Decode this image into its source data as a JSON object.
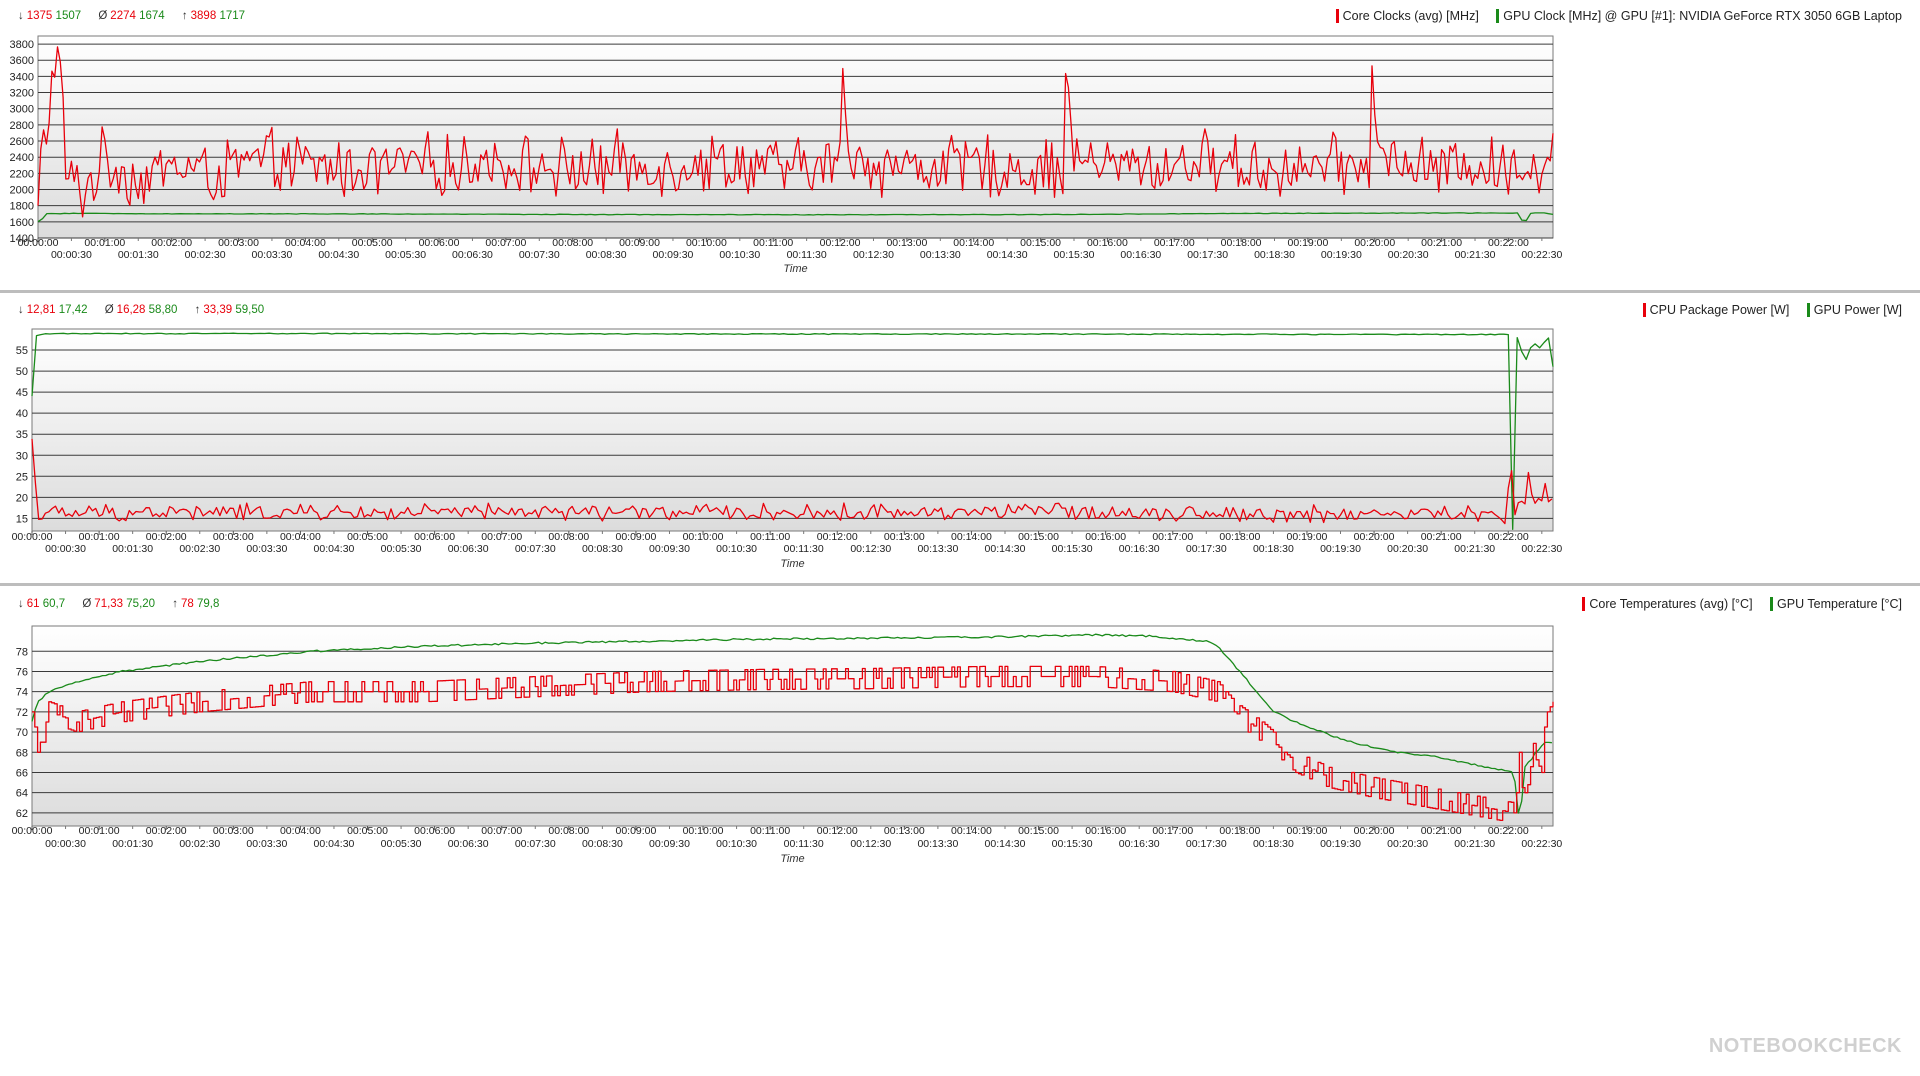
{
  "watermark": "NOTEBOOKCHECK",
  "colors": {
    "red": "#e8000b",
    "green": "#1a8a1a"
  },
  "time_ticks_top": [
    "00:00:00",
    "00:01:00",
    "00:02:00",
    "00:03:00",
    "00:04:00",
    "00:05:00",
    "00:06:00",
    "00:07:00",
    "00:08:00",
    "00:09:00",
    "00:10:00",
    "00:11:00",
    "00:12:00",
    "00:13:00",
    "00:14:00",
    "00:15:00",
    "00:16:00",
    "00:17:00",
    "00:18:00",
    "00:19:00",
    "00:20:00",
    "00:21:00",
    "00:22:00"
  ],
  "time_ticks_bottom": [
    "00:00:30",
    "00:01:30",
    "00:02:30",
    "00:03:30",
    "00:04:30",
    "00:05:30",
    "00:06:30",
    "00:07:30",
    "00:08:30",
    "00:09:30",
    "00:10:30",
    "00:11:30",
    "00:12:30",
    "00:13:30",
    "00:14:30",
    "00:15:30",
    "00:16:30",
    "00:17:30",
    "00:18:30",
    "00:19:30",
    "00:20:30",
    "00:21:30",
    "00:22:30"
  ],
  "chart_data": [
    {
      "type": "line",
      "xlabel": "Time",
      "ylim": [
        1400,
        3900
      ],
      "yticks": [
        1400,
        1600,
        1800,
        2000,
        2200,
        2400,
        2600,
        2800,
        3000,
        3200,
        3400,
        3600,
        3800
      ],
      "xlim_seconds": [
        0,
        1360
      ],
      "stats": {
        "min": {
          "symbol": "↓",
          "red": "1375",
          "green": "1507"
        },
        "avg": {
          "symbol": "Ø",
          "red": "2274",
          "green": "1674"
        },
        "max": {
          "symbol": "↑",
          "red": "3898",
          "green": "1717"
        }
      },
      "series": [
        {
          "name": "Core Clocks (avg) [MHz]",
          "color": "#e8000b",
          "style": "noisy",
          "points": [
            [
              0,
              1700
            ],
            [
              3,
              2500
            ],
            [
              8,
              2700
            ],
            [
              15,
              3650
            ],
            [
              20,
              3500
            ],
            [
              25,
              2200
            ],
            [
              40,
              1950
            ],
            [
              60,
              2400
            ],
            [
              90,
              2100
            ],
            [
              120,
              2300
            ],
            [
              160,
              2200
            ],
            [
              200,
              2350
            ],
            [
              240,
              2300
            ],
            [
              280,
              2250
            ],
            [
              320,
              2300
            ],
            [
              360,
              2280
            ],
            [
              400,
              2350
            ],
            [
              440,
              2300
            ],
            [
              480,
              2250
            ],
            [
              520,
              2300
            ],
            [
              560,
              2280
            ],
            [
              600,
              2350
            ],
            [
              640,
              2300
            ],
            [
              680,
              2250
            ],
            [
              718,
              2300
            ],
            [
              722,
              3500
            ],
            [
              726,
              2400
            ],
            [
              760,
              2300
            ],
            [
              800,
              2280
            ],
            [
              840,
              2300
            ],
            [
              880,
              2250
            ],
            [
              920,
              2300
            ],
            [
              924,
              3600
            ],
            [
              928,
              2400
            ],
            [
              960,
              2300
            ],
            [
              1000,
              2280
            ],
            [
              1040,
              2350
            ],
            [
              1080,
              2300
            ],
            [
              1120,
              2250
            ],
            [
              1195,
              2300
            ],
            [
              1198,
              3890
            ],
            [
              1202,
              2400
            ],
            [
              1240,
              2250
            ],
            [
              1280,
              2300
            ],
            [
              1320,
              2250
            ],
            [
              1360,
              2400
            ]
          ],
          "noise": 450,
          "step": 2.5
        },
        {
          "name": "GPU Clock [MHz] @ GPU [#1]: NVIDIA GeForce RTX 3050 6GB Laptop",
          "color": "#1a8a1a",
          "style": "smooth",
          "points": [
            [
              0,
              1600
            ],
            [
              2,
              1520
            ],
            [
              5,
              1700
            ],
            [
              30,
              1705
            ],
            [
              100,
              1700
            ],
            [
              300,
              1698
            ],
            [
              500,
              1690
            ],
            [
              700,
              1688
            ],
            [
              900,
              1690
            ],
            [
              1100,
              1705
            ],
            [
              1330,
              1710
            ],
            [
              1334,
              1530
            ],
            [
              1338,
              1705
            ],
            [
              1350,
              1715
            ],
            [
              1360,
              1690
            ]
          ],
          "noise": 6,
          "step": 4
        }
      ]
    },
    {
      "type": "line",
      "xlabel": "Time",
      "ylim": [
        12,
        60
      ],
      "yticks": [
        15,
        20,
        25,
        30,
        35,
        40,
        45,
        50,
        55
      ],
      "xlim_seconds": [
        0,
        1360
      ],
      "stats": {
        "min": {
          "symbol": "↓",
          "red": "12,81",
          "green": "17,42"
        },
        "avg": {
          "symbol": "Ø",
          "red": "16,28",
          "green": "58,80"
        },
        "max": {
          "symbol": "↑",
          "red": "33,39",
          "green": "59,50"
        }
      },
      "series": [
        {
          "name": "CPU Package Power [W]",
          "color": "#e8000b",
          "style": "noisy",
          "points": [
            [
              0,
              33.4
            ],
            [
              2,
              32
            ],
            [
              4,
              18
            ],
            [
              6,
              15
            ],
            [
              10,
              16
            ],
            [
              100,
              16.5
            ],
            [
              300,
              16.3
            ],
            [
              500,
              16.5
            ],
            [
              700,
              16.3
            ],
            [
              900,
              16.8
            ],
            [
              1100,
              16
            ],
            [
              1290,
              16
            ],
            [
              1318,
              15
            ],
            [
              1322,
              31
            ],
            [
              1326,
              16
            ],
            [
              1330,
              22
            ],
            [
              1334,
              16
            ],
            [
              1338,
              25
            ],
            [
              1345,
              17
            ],
            [
              1352,
              22
            ],
            [
              1360,
              17
            ]
          ],
          "noise": 2.4,
          "step": 3
        },
        {
          "name": "GPU Power [W]",
          "color": "#1a8a1a",
          "style": "smooth",
          "points": [
            [
              0,
              44
            ],
            [
              2,
              45
            ],
            [
              4,
              58.5
            ],
            [
              10,
              58.9
            ],
            [
              300,
              58.9
            ],
            [
              600,
              58.8
            ],
            [
              900,
              58.8
            ],
            [
              1200,
              58.7
            ],
            [
              1320,
              58.7
            ],
            [
              1322,
              30
            ],
            [
              1324,
              12.5
            ],
            [
              1328,
              58
            ],
            [
              1335,
              52
            ],
            [
              1342,
              57
            ],
            [
              1350,
              55
            ],
            [
              1355,
              59.5
            ],
            [
              1360,
              51
            ]
          ],
          "noise": 0.2,
          "step": 4
        }
      ]
    },
    {
      "type": "line",
      "xlabel": "Time",
      "ylim": [
        60.7,
        80.5
      ],
      "yticks": [
        62,
        64,
        66,
        68,
        70,
        72,
        74,
        76,
        78
      ],
      "xlim_seconds": [
        0,
        1360
      ],
      "stats": {
        "min": {
          "symbol": "↓",
          "red": "61",
          "green": "60,7"
        },
        "avg": {
          "symbol": "Ø",
          "red": "71,33",
          "green": "75,20"
        },
        "max": {
          "symbol": "↑",
          "red": "78",
          "green": "79,8"
        }
      },
      "series": [
        {
          "name": "Core Temperatures (avg) [°C]",
          "color": "#e8000b",
          "style": "steppy",
          "points": [
            [
              0,
              71
            ],
            [
              5,
              68
            ],
            [
              15,
              72
            ],
            [
              40,
              71
            ],
            [
              80,
              72
            ],
            [
              150,
              73
            ],
            [
              250,
              74
            ],
            [
              350,
              74
            ],
            [
              450,
              74.5
            ],
            [
              550,
              75
            ],
            [
              650,
              75.2
            ],
            [
              750,
              75.3
            ],
            [
              850,
              75.5
            ],
            [
              950,
              75.5
            ],
            [
              1020,
              75
            ],
            [
              1060,
              74
            ],
            [
              1075,
              72
            ],
            [
              1100,
              70
            ],
            [
              1130,
              67
            ],
            [
              1160,
              65.5
            ],
            [
              1200,
              64.5
            ],
            [
              1250,
              63.5
            ],
            [
              1300,
              62.5
            ],
            [
              1325,
              62
            ],
            [
              1330,
              68
            ],
            [
              1335,
              63
            ],
            [
              1342,
              68
            ],
            [
              1350,
              66
            ],
            [
              1355,
              73
            ],
            [
              1360,
              74
            ]
          ],
          "noise": 1.5,
          "step": 2.5
        },
        {
          "name": "GPU Temperature [°C]",
          "color": "#1a8a1a",
          "style": "smooth",
          "points": [
            [
              0,
              71
            ],
            [
              5,
              73
            ],
            [
              15,
              74
            ],
            [
              40,
              75
            ],
            [
              80,
              76
            ],
            [
              150,
              77
            ],
            [
              250,
              78
            ],
            [
              350,
              78.5
            ],
            [
              450,
              78.8
            ],
            [
              550,
              79
            ],
            [
              650,
              79.2
            ],
            [
              750,
              79.3
            ],
            [
              850,
              79.4
            ],
            [
              950,
              79.6
            ],
            [
              1000,
              79.5
            ],
            [
              1050,
              79
            ],
            [
              1060,
              78.5
            ],
            [
              1080,
              76
            ],
            [
              1110,
              72
            ],
            [
              1140,
              70.5
            ],
            [
              1180,
              69
            ],
            [
              1220,
              68
            ],
            [
              1260,
              67.5
            ],
            [
              1300,
              66.5
            ],
            [
              1325,
              66
            ],
            [
              1330,
              61
            ],
            [
              1335,
              66.5
            ],
            [
              1345,
              68
            ],
            [
              1352,
              69
            ],
            [
              1360,
              69
            ]
          ],
          "noise": 0.18,
          "step": 3
        }
      ]
    }
  ]
}
